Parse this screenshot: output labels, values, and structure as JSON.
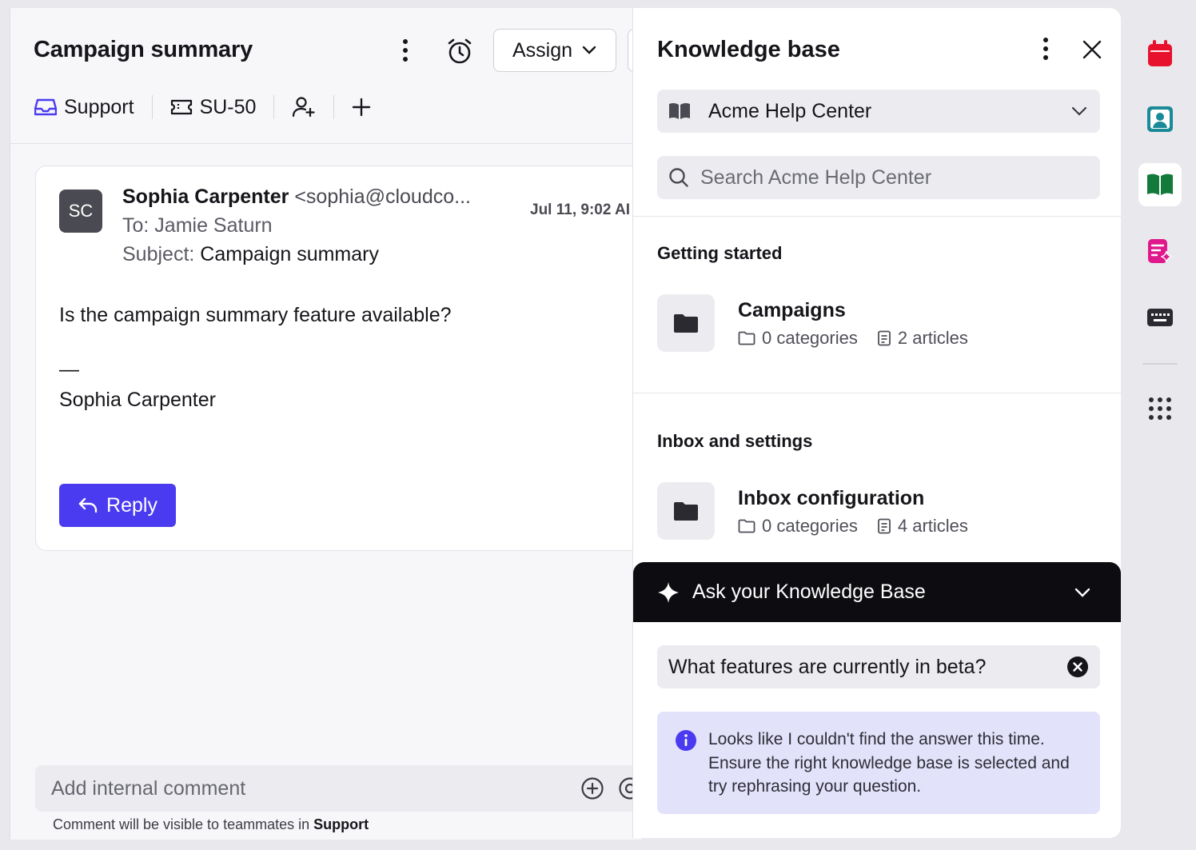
{
  "conversation": {
    "title": "Campaign summary",
    "assign_label": "Assign",
    "inbox_label": "Support",
    "ticket_id": "SU-50",
    "message": {
      "avatar_initials": "SC",
      "sender_name": "Sophia Carpenter",
      "sender_email": "<sophia@cloudco...",
      "date": "Jul 11, 9:02 AI",
      "to_line": "To: Jamie Saturn",
      "subject_label": "Subject:",
      "subject": "Campaign summary",
      "body": "Is the campaign summary feature available?",
      "signature_dash": "—",
      "signature": "Sophia Carpenter"
    },
    "reply_label": "Reply",
    "comment": {
      "placeholder": "Add internal comment",
      "note_prefix": "Comment will be visible to teammates in",
      "note_inbox": "Support"
    }
  },
  "knowledge_base": {
    "title": "Knowledge base",
    "selected_center": "Acme Help Center",
    "search_placeholder": "Search Acme Help Center",
    "sections": [
      {
        "title": "Getting started",
        "collection": {
          "name": "Campaigns",
          "categories": "0 categories",
          "articles": "2 articles"
        }
      },
      {
        "title": "Inbox and settings",
        "collection": {
          "name": "Inbox configuration",
          "categories": "0 categories",
          "articles": "4 articles"
        }
      }
    ],
    "ask": {
      "title": "Ask your Knowledge Base",
      "question": "What features are currently in beta?",
      "alert_text": "Looks like I couldn't find the answer this time. Ensure the right knowledge base is selected and try rephrasing your question."
    }
  },
  "rail": {
    "items": [
      "calendar-icon",
      "contact-icon",
      "knowledge-base-icon",
      "ai-compose-icon",
      "keyboard-icon",
      "apps-grid-icon"
    ],
    "active": "knowledge-base-icon"
  },
  "colors": {
    "primary": "#4a3bf0",
    "calendar": "#e8112d",
    "contact": "#1a8a99",
    "knowledge_base": "#137a3c",
    "ai_compose": "#e0188c",
    "ask_header_bg": "#0d0c10",
    "alert_bg": "#e3e2fb"
  }
}
